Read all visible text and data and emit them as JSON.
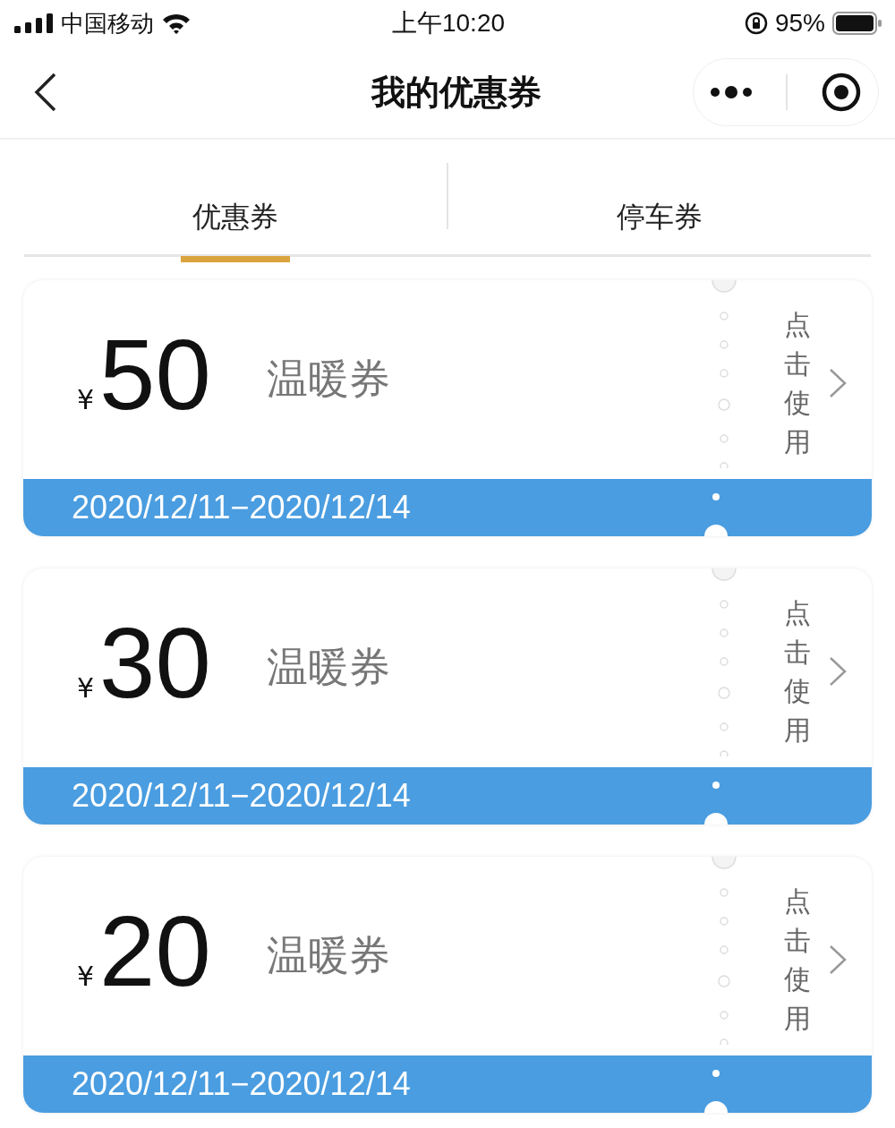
{
  "status_bar": {
    "carrier": "中国移动",
    "time": "上午10:20",
    "battery": "95%"
  },
  "nav": {
    "title": "我的优惠券"
  },
  "tabs": [
    {
      "label": "优惠券",
      "selected": true
    },
    {
      "label": "停车券",
      "selected": false
    }
  ],
  "coupons": [
    {
      "currency": "¥",
      "amount": "50",
      "name": "温暖券",
      "action": "点击使用",
      "validity": "2020/12/11−2020/12/14"
    },
    {
      "currency": "¥",
      "amount": "30",
      "name": "温暖券",
      "action": "点击使用",
      "validity": "2020/12/11−2020/12/14"
    },
    {
      "currency": "¥",
      "amount": "20",
      "name": "温暖券",
      "action": "点击使用",
      "validity": "2020/12/11−2020/12/14"
    }
  ]
}
